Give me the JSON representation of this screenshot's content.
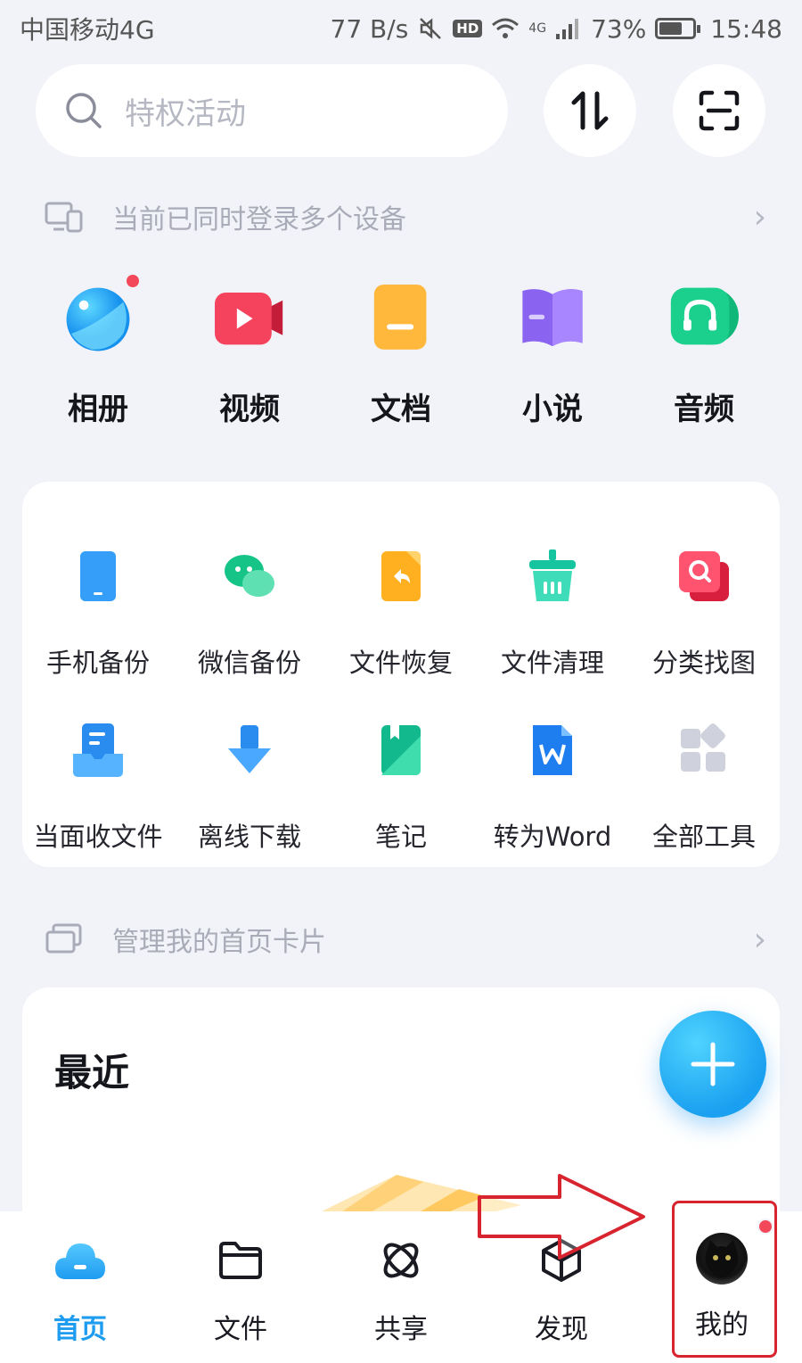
{
  "status_bar": {
    "carrier": "中国移动4G",
    "net_speed": "77 B/s",
    "hd": "HD",
    "signal_label": "4G",
    "battery": "73%",
    "battery_level": 0.73,
    "time": "15:48"
  },
  "search": {
    "placeholder": "特权活动",
    "icon": "search-icon"
  },
  "header_buttons": [
    {
      "icon": "transfer-icon"
    },
    {
      "icon": "scan-icon"
    }
  ],
  "device_notice": {
    "text": "当前已同时登录多个设备",
    "icon": "devices-icon"
  },
  "main_categories": [
    {
      "label": "相册",
      "icon": "album-icon",
      "color": "#1ea7f5",
      "badge": true
    },
    {
      "label": "视频",
      "icon": "video-icon",
      "color": "#f5435d",
      "badge": false
    },
    {
      "label": "文档",
      "icon": "document-icon",
      "color": "#ffa928",
      "badge": false
    },
    {
      "label": "小说",
      "icon": "novel-icon",
      "color": "#8a63f0",
      "badge": false
    },
    {
      "label": "音频",
      "icon": "audio-icon",
      "color": "#1bcf8d",
      "badge": false
    }
  ],
  "tools": [
    {
      "label": "手机备份",
      "icon": "phone-backup-icon"
    },
    {
      "label": "微信备份",
      "icon": "wechat-backup-icon"
    },
    {
      "label": "文件恢复",
      "icon": "file-restore-icon"
    },
    {
      "label": "文件清理",
      "icon": "file-clean-icon"
    },
    {
      "label": "分类找图",
      "icon": "find-image-icon"
    },
    {
      "label": "当面收文件",
      "icon": "receive-file-icon"
    },
    {
      "label": "离线下载",
      "icon": "offline-download-icon"
    },
    {
      "label": "笔记",
      "icon": "note-icon"
    },
    {
      "label": "转为Word",
      "icon": "word-convert-icon"
    },
    {
      "label": "全部工具",
      "icon": "all-tools-icon"
    }
  ],
  "manage_cards": {
    "text": "管理我的首页卡片",
    "icon": "cards-icon"
  },
  "recent": {
    "title": "最近"
  },
  "fab": {
    "icon": "plus-icon"
  },
  "bottom_nav": [
    {
      "label": "首页",
      "icon": "cloud-home-icon",
      "active": true
    },
    {
      "label": "文件",
      "icon": "folder-icon",
      "active": false
    },
    {
      "label": "共享",
      "icon": "share-icon",
      "active": false
    },
    {
      "label": "发现",
      "icon": "discover-icon",
      "active": false
    },
    {
      "label": "我的",
      "icon": "avatar",
      "active": false,
      "badge": true
    }
  ],
  "colors": {
    "accent": "#1e9cf0",
    "badge": "#f2485a",
    "annotation": "#d8242e",
    "background": "#f2f3f8"
  }
}
